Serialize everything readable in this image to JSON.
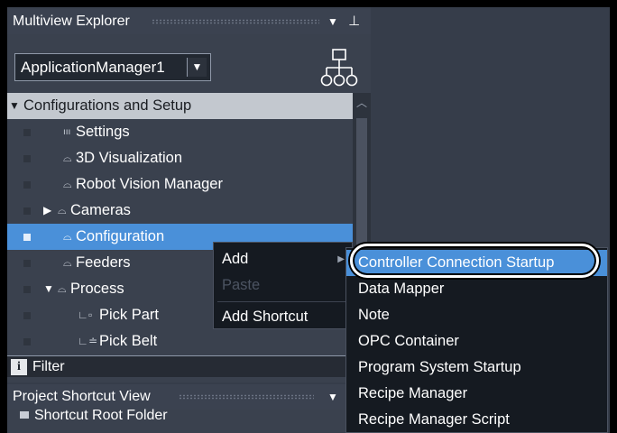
{
  "explorer": {
    "title": "Multiview Explorer",
    "pin_icon": "pin-icon",
    "dropdown_icon": "chevron-down-icon",
    "app_select": {
      "value": "ApplicationManager1"
    },
    "tree_icon": "hierarchy-icon",
    "tree": [
      {
        "label": "Configurations and Setup",
        "icon": "expanded-triangle-icon"
      },
      {
        "label": "Settings",
        "icon": "settings-icon"
      },
      {
        "label": "3D Visualization",
        "icon": "item-icon"
      },
      {
        "label": "Robot Vision Manager",
        "icon": "item-icon"
      },
      {
        "label": "Cameras",
        "icon": "folder-icon"
      },
      {
        "label": "Configuration",
        "icon": "item-icon"
      },
      {
        "label": "Feeders",
        "icon": "item-icon"
      },
      {
        "label": "Process",
        "icon": "folder-icon"
      },
      {
        "label": "Pick Part",
        "icon": "part-icon"
      },
      {
        "label": "Pick Belt",
        "icon": "belt-icon"
      }
    ],
    "filter": {
      "icon_letter": "i",
      "label": "Filter"
    }
  },
  "shortcut_view": {
    "title": "Project Shortcut View",
    "items": [
      {
        "label": "Shortcut Root Folder"
      }
    ]
  },
  "context_menu": {
    "items": [
      {
        "label": "Add",
        "has_submenu": true
      },
      {
        "label": "Paste",
        "disabled": true
      },
      {
        "label": "Add Shortcut"
      }
    ]
  },
  "submenu": {
    "items": [
      {
        "label": "Controller Connection Startup",
        "highlighted": true
      },
      {
        "label": "Data Mapper"
      },
      {
        "label": "Note"
      },
      {
        "label": "OPC Container"
      },
      {
        "label": "Program System Startup"
      },
      {
        "label": "Recipe Manager"
      },
      {
        "label": "Recipe Manager Script"
      }
    ]
  },
  "colors": {
    "panel_bg": "#3a414e",
    "selection": "#4a90d9",
    "menu_bg": "#151a21",
    "tree_header_bg": "#c3c8cf"
  }
}
